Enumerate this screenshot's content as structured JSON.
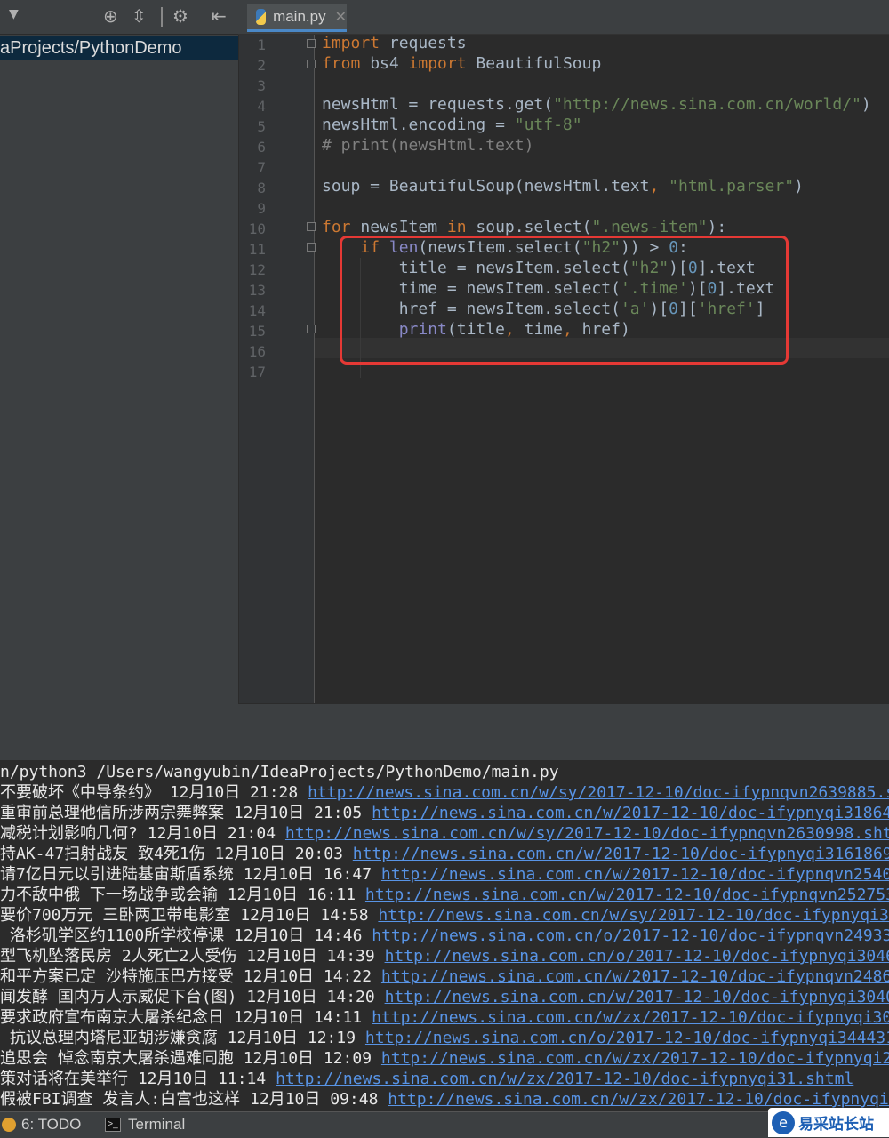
{
  "project": {
    "root_label": "aProjects/PythonDemo"
  },
  "editor": {
    "tab_name": "main.py",
    "line_numbers": [
      "1",
      "2",
      "3",
      "4",
      "5",
      "6",
      "7",
      "8",
      "9",
      "10",
      "11",
      "12",
      "13",
      "14",
      "15",
      "16",
      "17"
    ]
  },
  "run": {
    "command": "n/python3 /Users/wangyubin/IdeaProjects/PythonDemo/main.py",
    "rows": [
      {
        "title": "不要破坏《中导条约》",
        "time": "12月10日 21:28",
        "href": "http://news.sina.com.cn/w/sy/2017-12-10/doc-ifypnqvn2639885.sh"
      },
      {
        "title": "重审前总理他信所涉两宗舞弊案",
        "time": "12月10日 21:05",
        "href": "http://news.sina.com.cn/w/2017-12-10/doc-ifypnyqi318648"
      },
      {
        "title": "减税计划影响几何?",
        "time": "12月10日 21:04",
        "href": "http://news.sina.com.cn/w/sy/2017-12-10/doc-ifypnqvn2630998.sht"
      },
      {
        "title": "持AK-47扫射战友 致4死1伤",
        "time": "12月10日 20:03",
        "href": "http://news.sina.com.cn/w/2017-12-10/doc-ifypnyqi3161869."
      },
      {
        "title": "请7亿日元以引进陆基宙斯盾系统",
        "time": "12月10日 16:47",
        "href": "http://news.sina.com.cn/w/2017-12-10/doc-ifypnqvn25406"
      },
      {
        "title": "力不敌中俄 下一场战争或会输",
        "time": "12月10日 16:11",
        "href": "http://news.sina.com.cn/w/2017-12-10/doc-ifypnqvn252753"
      },
      {
        "title": "要价700万元 三卧两卫带电影室",
        "time": "12月10日 14:58",
        "href": "http://news.sina.com.cn/w/sy/2017-12-10/doc-ifypnyqi30"
      },
      {
        "title": " 洛杉矶学区约1100所学校停课",
        "time": "12月10日 14:46",
        "href": "http://news.sina.com.cn/o/2017-12-10/doc-ifypnqvn249337"
      },
      {
        "title": "型飞机坠落民房 2人死亡2人受伤",
        "time": "12月10日 14:39",
        "href": "http://news.sina.com.cn/o/2017-12-10/doc-ifypnyqi30465"
      },
      {
        "title": "和平方案已定 沙特施压巴方接受",
        "time": "12月10日 14:22",
        "href": "http://news.sina.com.cn/w/2017-12-10/doc-ifypnqvn24863"
      },
      {
        "title": "闻发酵 国内万人示威促下台(图)",
        "time": "12月10日 14:20",
        "href": "http://news.sina.com.cn/w/2017-12-10/doc-ifypnyqi30400"
      },
      {
        "title": "要求政府宣布南京大屠杀纪念日",
        "time": "12月10日 14:11",
        "href": "http://news.sina.com.cn/w/zx/2017-12-10/doc-ifypnyqi3030"
      },
      {
        "title": " 抗议总理内塔尼亚胡涉嫌贪腐",
        "time": "12月10日 12:19",
        "href": "http://news.sina.com.cn/o/2017-12-10/doc-ifypnyqi344431"
      },
      {
        "title": "追思会 悼念南京大屠杀遇难同胞",
        "time": "12月10日 12:09",
        "href": "http://news.sina.com.cn/w/zx/2017-12-10/doc-ifypnyqi2emf62"
      },
      {
        "title": "策对话将在美举行",
        "time": "12月10日 11:14",
        "href": "http://news.sina.com.cn/w/zx/2017-12-10/doc-ifypnyqi31.shtml"
      },
      {
        "title": "假被FBI调查 发言人:白宫也这样",
        "time": "12月10日 09:48",
        "href": "http://news.sina.com.cn/w/zx/2017-12-10/doc-ifypnyqi2"
      }
    ]
  },
  "status_bar": {
    "todo_label": "6: TODO",
    "terminal_label": "Terminal"
  },
  "watermark": {
    "text": "易采站长站",
    "logo_glyph": "e"
  },
  "colors": {
    "keyword": "#cc7832",
    "string": "#6a8759",
    "link": "#5894e6",
    "highlight_box": "#e53935"
  }
}
